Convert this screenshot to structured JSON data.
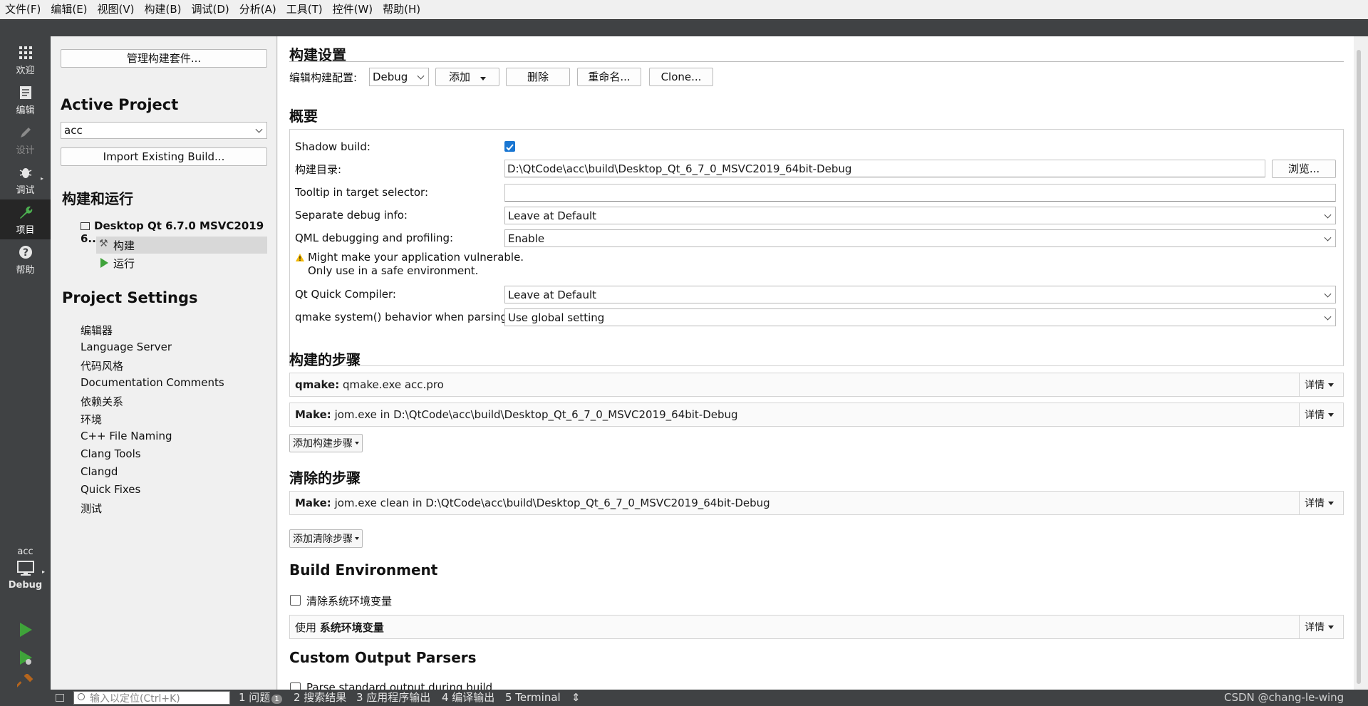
{
  "menu": [
    "文件(F)",
    "编辑(E)",
    "视图(V)",
    "构建(B)",
    "调试(D)",
    "分析(A)",
    "工具(T)",
    "控件(W)",
    "帮助(H)"
  ],
  "modes": [
    {
      "label": "欢迎",
      "icon": "grid-icon"
    },
    {
      "label": "编辑",
      "icon": "document-icon"
    },
    {
      "label": "设计",
      "icon": "pencil-icon"
    },
    {
      "label": "调试",
      "icon": "bug-icon"
    },
    {
      "label": "项目",
      "icon": "wrench-icon"
    },
    {
      "label": "帮助",
      "icon": "help-icon"
    }
  ],
  "kit_selector": {
    "project": "acc",
    "config": "Debug"
  },
  "nav": {
    "manage_kits": "管理构建套件...",
    "active_project_title": "Active Project",
    "active_project": "acc",
    "import_build": "Import Existing Build...",
    "build_run_title": "构建和运行",
    "kit_name": "Desktop Qt 6.7.0 MSVC2019 6...",
    "build_item": "构建",
    "run_item": "运行",
    "project_settings_title": "Project Settings",
    "settings_items": [
      "编辑器",
      "Language Server",
      "代码风格",
      "Documentation Comments",
      "依赖关系",
      "环境",
      "C++ File Naming",
      "Clang Tools",
      "Clangd",
      "Quick Fixes",
      "测试"
    ]
  },
  "build_settings": {
    "title": "构建设置",
    "edit_config_label": "编辑构建配置:",
    "config_value": "Debug",
    "add": "添加",
    "delete": "删除",
    "rename": "重命名...",
    "clone": "Clone..."
  },
  "overview": {
    "title": "概要",
    "shadow_build_label": "Shadow build:",
    "shadow_build_checked": true,
    "build_dir_label": "构建目录:",
    "build_dir": "D:\\QtCode\\acc\\build\\Desktop_Qt_6_7_0_MSVC2019_64bit-Debug",
    "browse": "浏览...",
    "tooltip_label": "Tooltip in target selector:",
    "tooltip_value": "",
    "sep_debug_label": "Separate debug info:",
    "sep_debug_value": "Leave at Default",
    "qml_debug_label": "QML debugging and profiling:",
    "qml_debug_value": "Enable",
    "warning_line1": "Might make your application vulnerable.",
    "warning_line2": "Only use in a safe environment.",
    "quick_compiler_label": "Qt Quick Compiler:",
    "quick_compiler_value": "Leave at Default",
    "qmake_system_label": "qmake system() behavior when parsing:",
    "qmake_system_value": "Use global setting"
  },
  "build_steps": {
    "title": "构建的步骤",
    "steps": [
      {
        "name": "qmake:",
        "desc": "qmake.exe acc.pro"
      },
      {
        "name": "Make:",
        "desc": "jom.exe in D:\\QtCode\\acc\\build\\Desktop_Qt_6_7_0_MSVC2019_64bit-Debug"
      }
    ],
    "add_step": "添加构建步骤",
    "details": "详情"
  },
  "clean_steps": {
    "title": "清除的步骤",
    "steps": [
      {
        "name": "Make:",
        "desc": "jom.exe clean in D:\\QtCode\\acc\\build\\Desktop_Qt_6_7_0_MSVC2019_64bit-Debug"
      }
    ],
    "add_step": "添加清除步骤",
    "details": "详情"
  },
  "build_env": {
    "title": "Build Environment",
    "clear_env_label": "清除系统环境变量",
    "use_prefix": "使用",
    "use_env": "系统环境变量",
    "details": "详情"
  },
  "custom_parsers": {
    "title": "Custom Output Parsers",
    "parse_stdout": "Parse standard output during build"
  },
  "status": {
    "locator_placeholder": "输入以定位(Ctrl+K)",
    "issues": "1 问题",
    "issues_count": "1",
    "search_results": "2 搜索结果",
    "app_output": "3 应用程序输出",
    "compile_output": "4 编译输出",
    "terminal": "5 Terminal",
    "watermark": "CSDN @chang-le-wing"
  },
  "colors": {
    "accent": "#1976d2",
    "run_green": "#3fa33a",
    "sidebar": "#404244",
    "selection": "#d8d8d8"
  }
}
